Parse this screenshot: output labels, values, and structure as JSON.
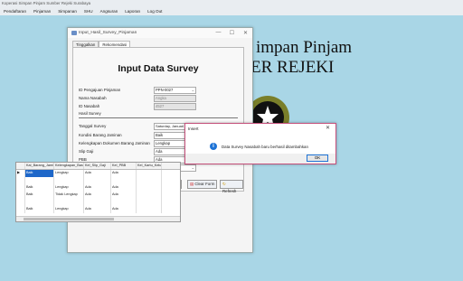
{
  "app": {
    "title": "Koperasi Simpan Pinjam Sumber Rejeki Surabaya"
  },
  "menu": [
    "Pendaftaran",
    "Pinjaman",
    "Simpanan",
    "SHU",
    "Angsuran",
    "Laporan",
    "Log Out"
  ],
  "background": {
    "line1": "impan Pinjam",
    "line2": "ER REJEKI"
  },
  "window": {
    "title": "Input_Hasil_Survey_Pinjaman",
    "controls": [
      "—",
      "☐",
      "✕"
    ],
    "tabs": [
      "Tinggalkan",
      "Rekomendasi"
    ],
    "heading": "Input Data Survey",
    "fields": [
      {
        "label": "ID Pengajuan Pinjaman",
        "value": "PPN-0027",
        "type": "dropdown"
      },
      {
        "label": "Nama Nasabah",
        "value": "Angka",
        "type": "readonly"
      },
      {
        "label": "ID Nasabah",
        "value": "4527",
        "type": "readonly"
      }
    ],
    "section_label": "Hasil Survey",
    "date": {
      "label": "Tanggal Survey",
      "day": "Saturday",
      "month": "Januari",
      "dd": "21",
      "year": "2017"
    },
    "survey_fields": [
      {
        "label": "Kondisi Barang Jaminan",
        "value": "Baik"
      },
      {
        "label": "Kelengkapan Dokumen Barang Jaminan",
        "value": "Lengkap"
      },
      {
        "label": "Slip Gaji",
        "value": "Ada"
      },
      {
        "label": "PBB",
        "value": "Ada"
      },
      {
        "label": "Kartu Keluarga",
        "value": "Ada"
      }
    ],
    "buttons": {
      "save": "Save",
      "clear": "Clear Form",
      "refresh": "Refresh"
    },
    "grid": {
      "columns": [
        "",
        "Kal_Barang_Jamin",
        "Kelengkapan_Baran",
        "Kel_Slip_Gaji",
        "Kel_PBB",
        "Kel_Kartu_Keluarga"
      ],
      "rows": [
        [
          "▶",
          "Baik",
          "Lengkap",
          "Ada",
          "Ada",
          ""
        ],
        [
          "",
          "",
          "",
          "",
          "",
          ""
        ],
        [
          "",
          "Baik",
          "Lengkap",
          "Ada",
          "Ada",
          ""
        ],
        [
          "",
          "Baik",
          "Tidak Lengkap",
          "Ada",
          "Ada",
          ""
        ],
        [
          "",
          "",
          "",
          "",
          "",
          ""
        ],
        [
          "",
          "Baik",
          "Lengkap",
          "Ada",
          "Ada",
          ""
        ]
      ]
    }
  },
  "dialog": {
    "title": "Insert",
    "close": "✕",
    "message": "Data Survey Nasabah baru berhasil ditambahkan",
    "ok": "OK"
  }
}
